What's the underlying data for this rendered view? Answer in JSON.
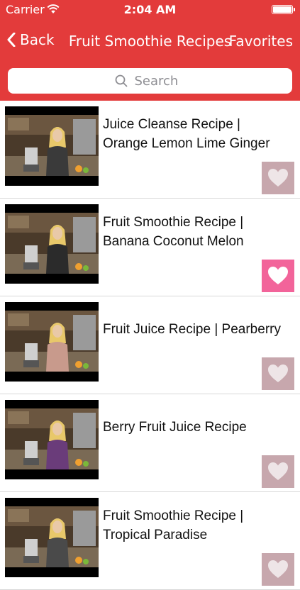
{
  "status_bar": {
    "carrier": "Carrier",
    "time": "2:04 AM"
  },
  "nav": {
    "back_label": "Back",
    "title": "Fruit Smoothie Recipes",
    "favorites_label": "Favorites"
  },
  "search": {
    "placeholder": "Search"
  },
  "colors": {
    "bar": "#e33b3b",
    "heart_inactive": "#c7a7ad",
    "heart_active": "#f2649a"
  },
  "recipes": [
    {
      "title": "Juice Cleanse Recipe | Orange Lemon Lime Ginger",
      "favorite": false
    },
    {
      "title": "Fruit Smoothie Recipe | Banana Coconut Melon",
      "favorite": true
    },
    {
      "title": "Fruit Juice Recipe | Pearberry",
      "favorite": false
    },
    {
      "title": "Berry Fruit Juice Recipe",
      "favorite": false
    },
    {
      "title": "Fruit Smoothie Recipe | Tropical Paradise",
      "favorite": false
    }
  ]
}
